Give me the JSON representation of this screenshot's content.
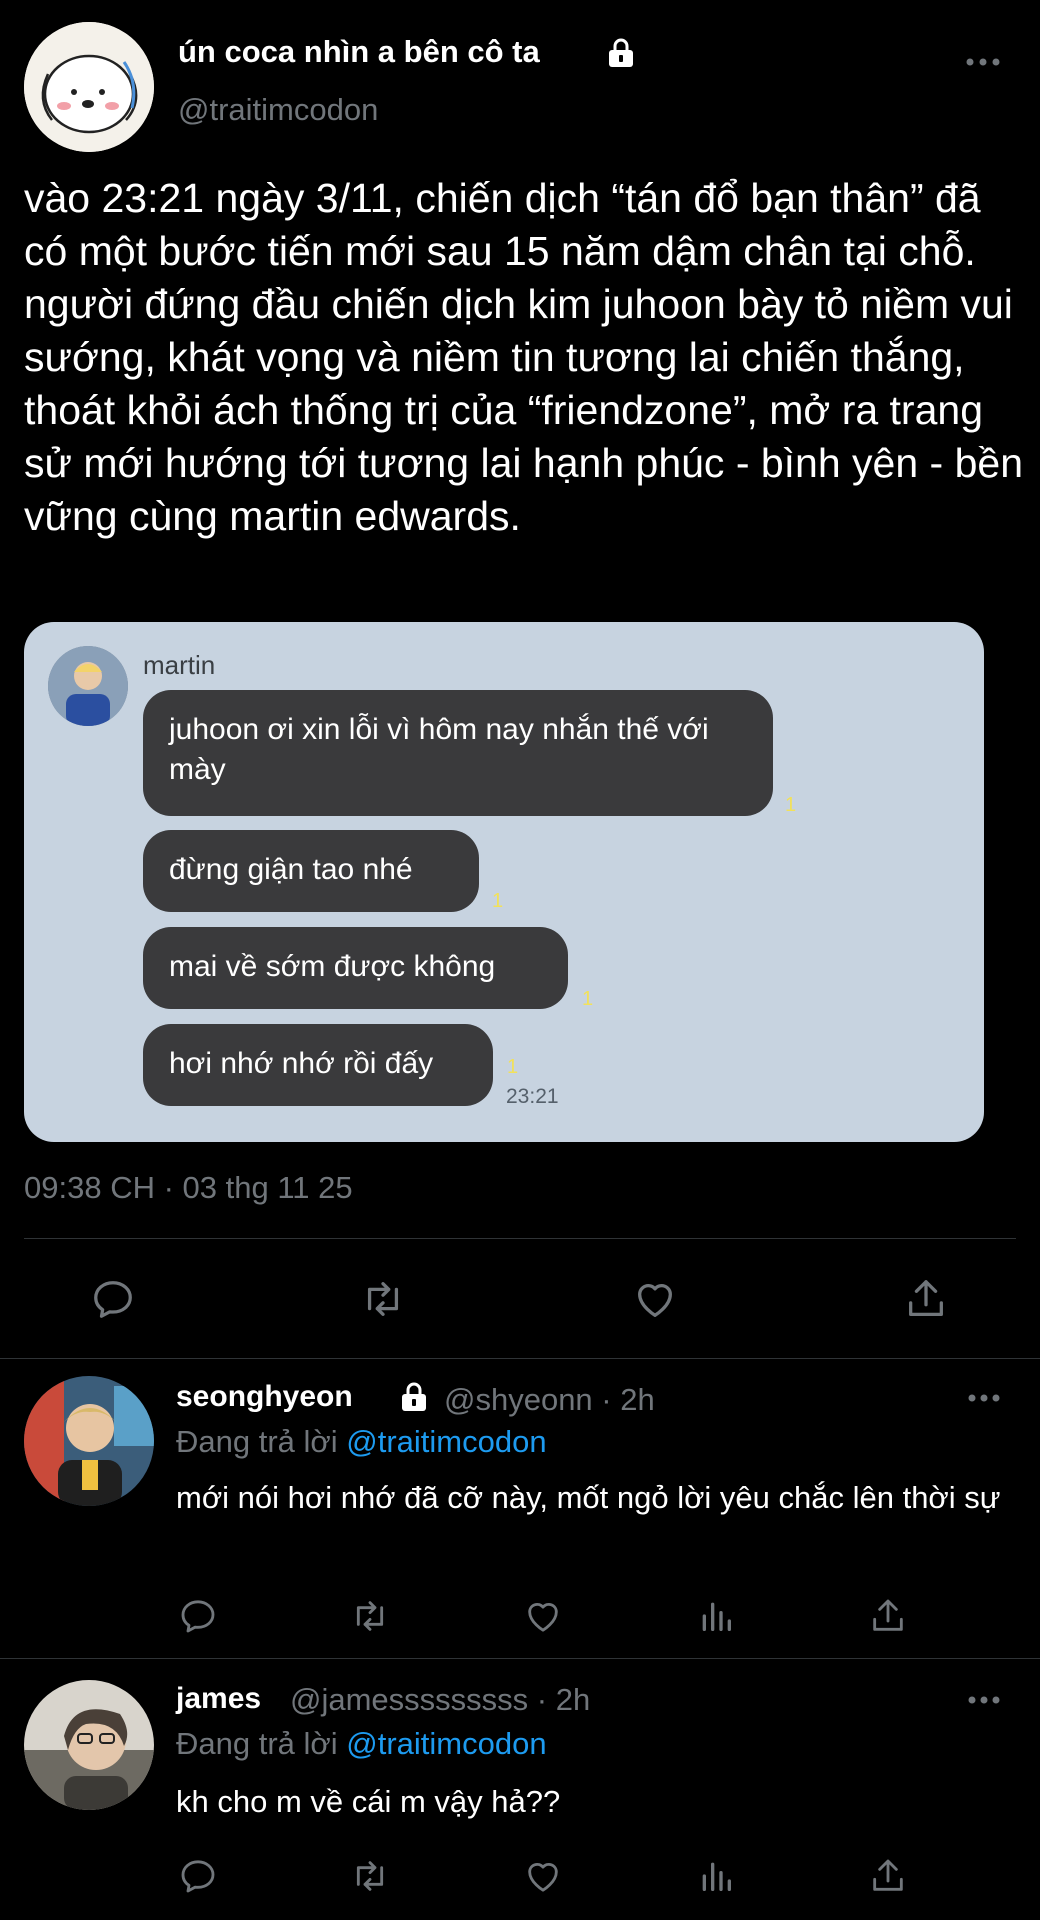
{
  "tweet": {
    "display_name": "ún coca nhìn a bên cô ta",
    "handle": "@traitimcodon",
    "text": "vào 23:21 ngày 3/11, chiến dịch “tán đổ bạn thân” đã có một bước tiến mới sau 15 năm dậm chân tại chỗ. người đứng đầu chiến dịch kim juhoon bày tỏ niềm vui sướng, khát vọng và niềm tin tương lai chiến thắng, thoát khỏi ách thống trị của “friendzone”, mở ra trang sử mới hướng tới tương lai hạnh phúc - bình yên - bền vững cùng martin edwards.",
    "timestamp": "09:38 CH · 03 thg 11 25"
  },
  "chat": {
    "sender": "martin",
    "messages": [
      {
        "text": "juhoon ơi xin lỗi vì hôm nay nhắn thế với mày",
        "read": "1"
      },
      {
        "text": "đừng giận tao nhé",
        "read": "1"
      },
      {
        "text": "mai về sớm được không",
        "read": "1"
      },
      {
        "text": "hơi nhớ nhớ rồi đấy",
        "read": "1"
      }
    ],
    "time": "23:21"
  },
  "replies": [
    {
      "name": "seonghyeon",
      "handle_time": "@shyeonn · 2h",
      "replying_prefix": "Đang trả lời ",
      "replying_to": "@traitimcodon",
      "text": "mới nói hơi nhớ đã cỡ này, mốt ngỏ lời yêu chắc lên thời sự"
    },
    {
      "name": "james",
      "handle_time": "@jamesssssssss · 2h",
      "replying_prefix": "Đang trả lời ",
      "replying_to": "@traitimcodon",
      "text": "kh cho m về cái m vậy hả??"
    }
  ],
  "icons": {
    "reply": "reply-icon",
    "retweet": "retweet-icon",
    "like": "heart-icon",
    "share": "share-icon",
    "views": "views-icon",
    "more": "more-icon",
    "lock": "lock-icon"
  },
  "colors": {
    "background": "#000000",
    "mention": "#1d9bf0",
    "secondary_text": "#71767b",
    "chat_background": "#c7d3e0",
    "bubble": "#3a3a3c",
    "read_marker": "#f2e15a"
  }
}
